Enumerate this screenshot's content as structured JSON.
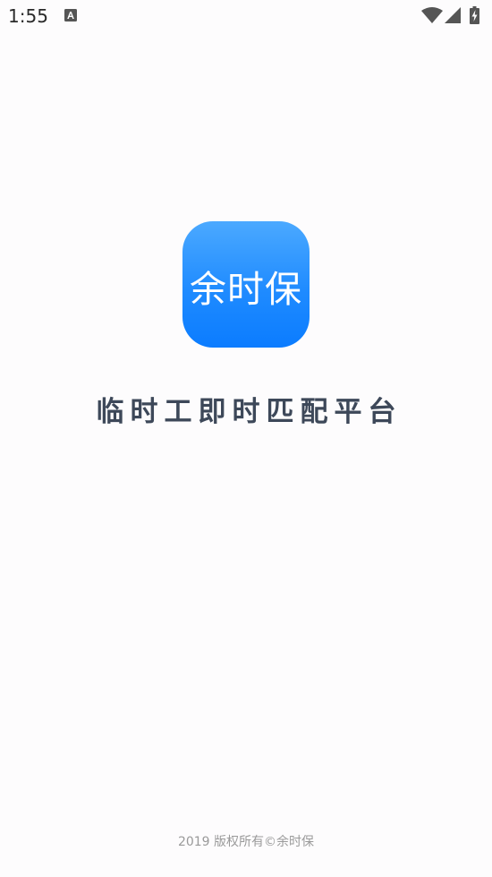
{
  "status_bar": {
    "time": "1:55",
    "icons": [
      "notification-a-icon",
      "wifi-icon",
      "signal-icon",
      "battery-charging-icon"
    ]
  },
  "app": {
    "logo_text": "余时保",
    "logo_color": "#1f8bff"
  },
  "tagline": "临时工即时匹配平台",
  "footer": {
    "copyright": "2019 版权所有©余时保"
  }
}
